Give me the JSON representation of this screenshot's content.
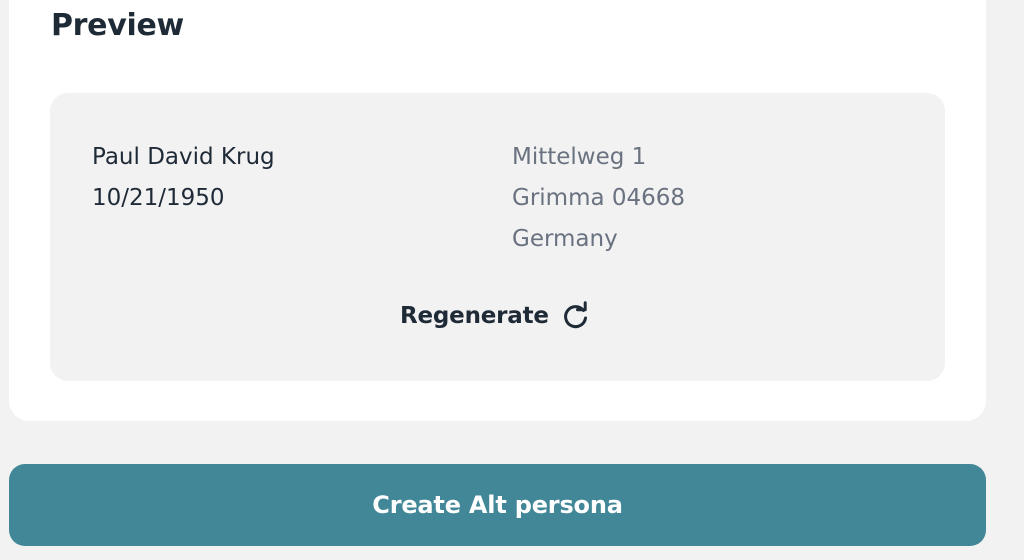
{
  "preview": {
    "title": "Preview",
    "person": {
      "name": "Paul David Krug",
      "birthdate": "10/21/1950"
    },
    "address": {
      "street": "Mittelweg 1",
      "city": "Grimma 04668",
      "country": "Germany"
    },
    "regenerate_label": "Regenerate",
    "regenerate_icon": "refresh-icon"
  },
  "actions": {
    "create_label": "Create Alt persona"
  },
  "colors": {
    "primary": "#418797",
    "card_bg": "#ffffff",
    "page_bg": "#f2f2f2",
    "preview_bg": "#f2f2f3",
    "text_dark": "#1f2a37",
    "text_muted": "#6a7280"
  }
}
